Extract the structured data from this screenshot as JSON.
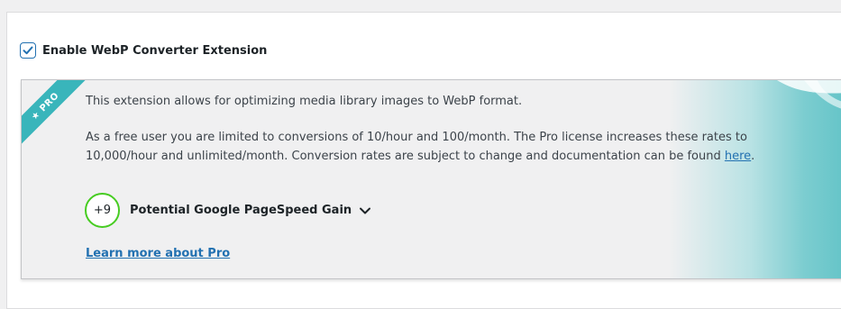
{
  "enable": {
    "label": "Enable WebP Converter Extension",
    "checked": true
  },
  "pro_box": {
    "ribbon": "★ PRO",
    "description": "This extension allows for optimizing media library images to WebP format.",
    "limits_text": "As a free user you are limited to conversions of 10/hour and 100/month. The Pro license increases these rates to 10,000/hour and unlimited/month. Conversion rates are subject to change and documentation can be found ",
    "limits_link": "here",
    "limits_end": ".",
    "gain_value": "+9",
    "gain_label": "Potential Google PageSpeed Gain",
    "learn_more": "Learn more about Pro"
  },
  "colors": {
    "accent": "#2271b1",
    "ribbon": "#39b5bb",
    "gain_ring": "#46cc21",
    "gradient_end": "#62c3c7"
  },
  "icons": {
    "checkbox": "check-icon",
    "chevron": "chevron-down-icon"
  }
}
